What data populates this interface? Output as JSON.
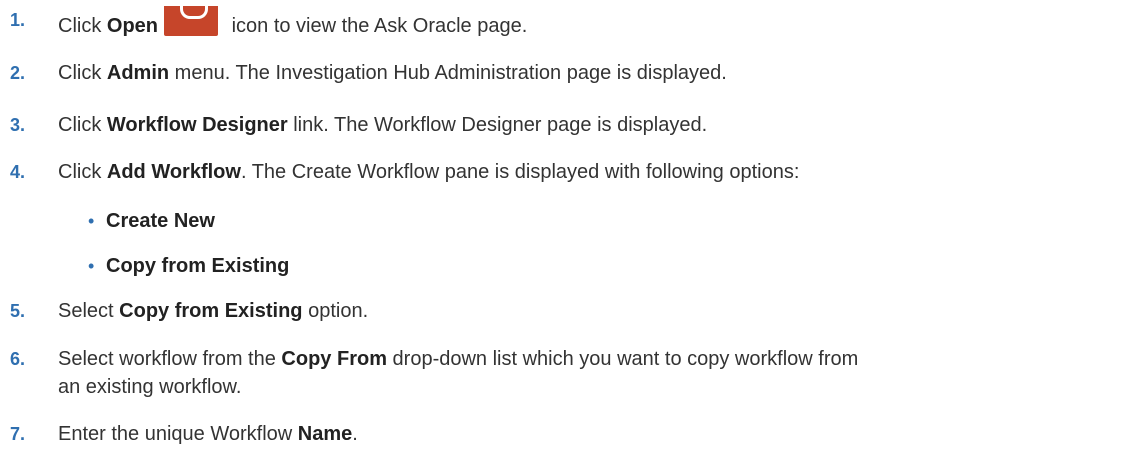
{
  "steps": [
    {
      "num": "1.",
      "a": "Click ",
      "b": "Open",
      "c": " icon to view the Ask Oracle page."
    },
    {
      "num": "2.",
      "a": "Click ",
      "b": "Admin",
      "c": " menu. The Investigation Hub Administration page is displayed."
    },
    {
      "num": "3.",
      "a": "Click ",
      "b": "Workflow Designer",
      "c": " link. The Workflow Designer page is displayed."
    },
    {
      "num": "4.",
      "a": "Click ",
      "b": "Add Workflow",
      "c": ". The Create Workflow pane is displayed with following options:"
    },
    {
      "num": "5.",
      "a": "Select ",
      "b": "Copy from Existing",
      "c": " option."
    },
    {
      "num": "6.",
      "a": "Select workflow from the ",
      "b": "Copy From",
      "c": " drop-down list which you want to copy workflow from",
      "d": "an existing workflow."
    },
    {
      "num": "7.",
      "a": "Enter the unique Workflow ",
      "b": "Name",
      "c": "."
    }
  ],
  "bullets": [
    {
      "symbol": "•",
      "label": "Create New"
    },
    {
      "symbol": "•",
      "label": "Copy from Existing"
    }
  ],
  "icons": {
    "open_icon": "open-icon",
    "open_icon_color": "#c6452a"
  }
}
